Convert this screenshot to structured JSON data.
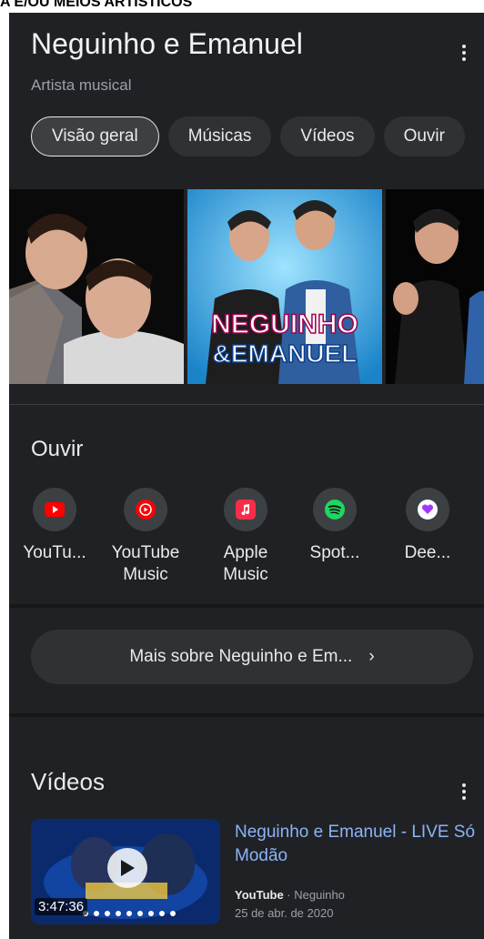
{
  "doc_header": "A E/OU MEIOS ARTÍSTICOS",
  "header": {
    "title": "Neguinho e Emanuel",
    "subtitle": "Artista musical"
  },
  "chips": [
    "Visão geral",
    "Músicas",
    "Vídeos",
    "Ouvir"
  ],
  "gallery": {
    "poster_text_line1": "NEGUINHO",
    "poster_text_line2": "&EMANUEL"
  },
  "listen": {
    "title": "Ouvir",
    "items": [
      {
        "label": "YouTu...",
        "icon": "youtube-icon",
        "color": "#ff0000"
      },
      {
        "label": "YouTube Music",
        "icon": "youtube-music-icon",
        "color": "#ff0000"
      },
      {
        "label": "Apple Music",
        "icon": "apple-music-icon",
        "color": "#fa2d48"
      },
      {
        "label": "Spot...",
        "icon": "spotify-icon",
        "color": "#1ed760"
      },
      {
        "label": "Dee...",
        "icon": "deezer-icon",
        "color": "#a238ff"
      }
    ]
  },
  "more_button": {
    "label": "Mais sobre Neguinho e Em...",
    "chevron": "›"
  },
  "videos": {
    "title": "Vídeos",
    "items": [
      {
        "title": "Neguinho e Emanuel - LIVE Só Modão",
        "source": "YouTube",
        "channel": "Neguinho",
        "date": "25 de abr. de 2020",
        "duration": "3:47:36"
      }
    ]
  }
}
